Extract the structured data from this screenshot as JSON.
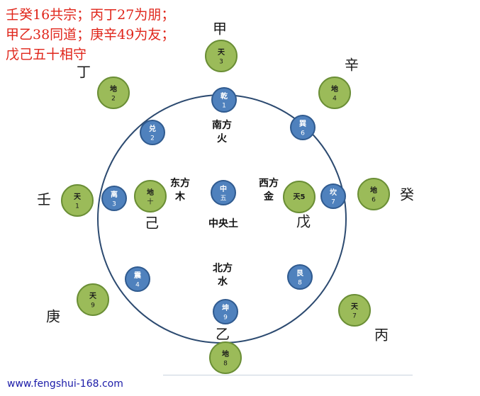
{
  "header": {
    "line1": "壬癸16共宗；丙丁27为朋；",
    "line2": "甲乙38同道；庚辛49为友；",
    "line3": "戊己五十相守"
  },
  "colors": {
    "green_fill": "#9bbb59",
    "green_stroke": "#6a8e35",
    "blue_fill": "#4f81bd",
    "blue_stroke": "#2f5a8f",
    "ring": "#2c4a70",
    "title": "#e0261b",
    "footer": "#1a1aa8"
  },
  "stems": [
    {
      "id": "jia",
      "text": "甲"
    },
    {
      "id": "xin",
      "text": "辛"
    },
    {
      "id": "ding",
      "text": "丁"
    },
    {
      "id": "ren",
      "text": "壬"
    },
    {
      "id": "gui",
      "text": "癸"
    },
    {
      "id": "ji",
      "text": "己"
    },
    {
      "id": "wu",
      "text": "戊"
    },
    {
      "id": "geng",
      "text": "庚"
    },
    {
      "id": "bing",
      "text": "丙"
    },
    {
      "id": "yi",
      "text": "乙"
    }
  ],
  "green_nodes": [
    {
      "id": "n",
      "top": "天",
      "bottom": "3"
    },
    {
      "id": "nw",
      "top": "地",
      "bottom": "2"
    },
    {
      "id": "ne",
      "top": "地",
      "bottom": "4"
    },
    {
      "id": "w",
      "top": "天",
      "bottom": "1"
    },
    {
      "id": "e",
      "top": "地",
      "bottom": "6"
    },
    {
      "id": "sw",
      "top": "天",
      "bottom": "9"
    },
    {
      "id": "se",
      "top": "天",
      "bottom": "7"
    },
    {
      "id": "s",
      "top": "地",
      "bottom": "8"
    },
    {
      "id": "center_w",
      "top": "地",
      "bottom": "十"
    },
    {
      "id": "center_e",
      "top": "天5",
      "bottom": ""
    }
  ],
  "blue_nodes": [
    {
      "id": "qian",
      "top": "乾",
      "bottom": "1"
    },
    {
      "id": "dui",
      "top": "兑",
      "bottom": "2"
    },
    {
      "id": "xun",
      "top": "巽",
      "bottom": "6"
    },
    {
      "id": "li",
      "top": "离",
      "bottom": "3"
    },
    {
      "id": "zhong",
      "top": "中",
      "bottom": "五"
    },
    {
      "id": "kan",
      "top": "坎",
      "bottom": "7"
    },
    {
      "id": "zhen",
      "top": "震",
      "bottom": "4"
    },
    {
      "id": "gen",
      "top": "艮",
      "bottom": "8"
    },
    {
      "id": "kun",
      "top": "坤",
      "bottom": "9"
    }
  ],
  "directions": [
    {
      "id": "south",
      "line1": "南方",
      "line2": "火"
    },
    {
      "id": "east",
      "line1": "东方",
      "line2": "木"
    },
    {
      "id": "west",
      "line1": "西方",
      "line2": "金"
    },
    {
      "id": "center",
      "line1": "中央土",
      "line2": ""
    },
    {
      "id": "north",
      "line1": "北方",
      "line2": "水"
    }
  ],
  "footer": "www.fengshui-168.com"
}
